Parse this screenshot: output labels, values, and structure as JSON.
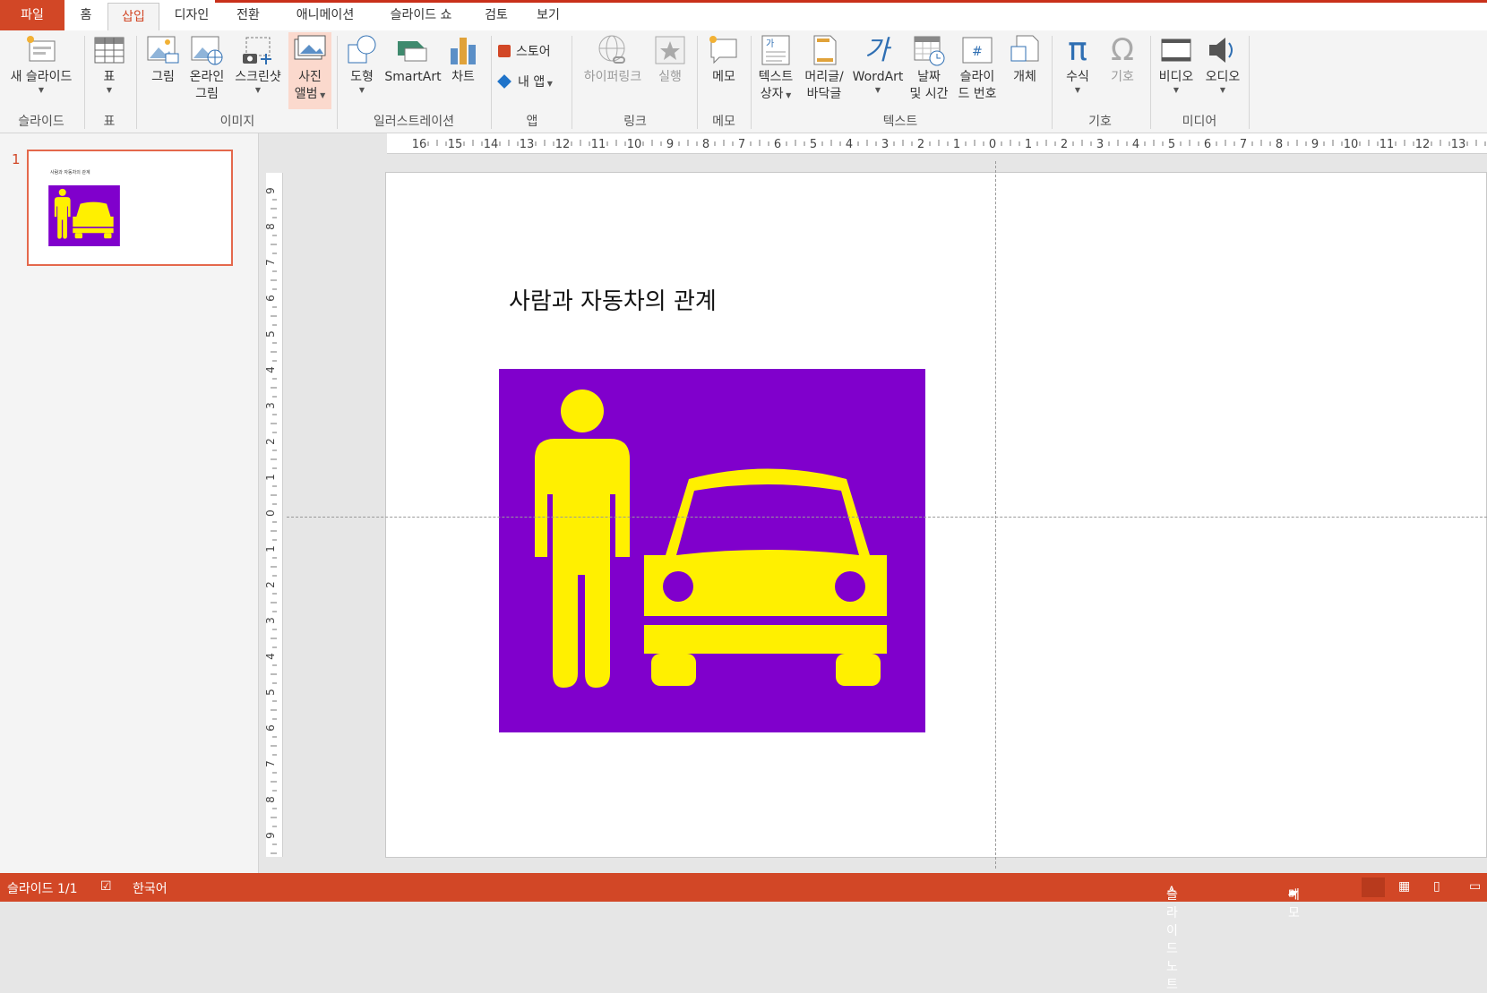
{
  "tabs": [
    "파일",
    "홈",
    "삽입",
    "디자인",
    "전환",
    "애니메이션",
    "슬라이드 쇼",
    "검토",
    "보기"
  ],
  "ribbon": {
    "new_slide": "새 슬라이드",
    "table": "표",
    "picture": "그림",
    "online_picture_1": "온라인",
    "online_picture_2": "그림",
    "screenshot": "스크린샷",
    "photo_album_1": "사진",
    "photo_album_2": "앨범",
    "shapes": "도형",
    "smartart": "SmartArt",
    "chart": "차트",
    "store": "스토어",
    "my_apps": "내 앱",
    "hyperlink": "하이퍼링크",
    "action": "실행",
    "comment": "메모",
    "textbox_1": "텍스트",
    "textbox_2": "상자",
    "header_footer_1": "머리글/",
    "header_footer_2": "바닥글",
    "wordart": "WordArt",
    "datetime_1": "날짜",
    "datetime_2": "및 시간",
    "slide_number_1": "슬라이",
    "slide_number_2": "드 번호",
    "object": "개체",
    "equation": "수식",
    "symbol": "기호",
    "video": "비디오",
    "audio": "오디오",
    "groups": [
      "슬라이드",
      "표",
      "이미지",
      "일러스트레이션",
      "앱",
      "링크",
      "메모",
      "텍스트",
      "기호",
      "미디어"
    ]
  },
  "ruler": {
    "h_ticks": [
      "16",
      "15",
      "14",
      "13",
      "12",
      "11",
      "10",
      "9",
      "8",
      "7",
      "6",
      "5",
      "4",
      "3",
      "2",
      "1",
      "0",
      "1",
      "2",
      "3",
      "4",
      "5",
      "6",
      "7",
      "8",
      "9",
      "10",
      "11",
      "12",
      "13"
    ],
    "v_ticks": [
      "9",
      "8",
      "7",
      "6",
      "5",
      "4",
      "3",
      "2",
      "1",
      "0",
      "1",
      "2",
      "3",
      "4",
      "5",
      "6",
      "7",
      "8",
      "9"
    ]
  },
  "thumbnails": [
    {
      "number": "1",
      "title": "사람과 자동차의 관계"
    }
  ],
  "slide": {
    "title": "사람과 자동차의 관계",
    "picture_bg": "#8000CC",
    "picture_fg": "#FFF000"
  },
  "status": {
    "slide_indicator": "슬라이드 1/1",
    "language": "한국어",
    "notes": "슬라이드 노트",
    "comments": "메모"
  },
  "colors": {
    "accent": "#D24726"
  }
}
